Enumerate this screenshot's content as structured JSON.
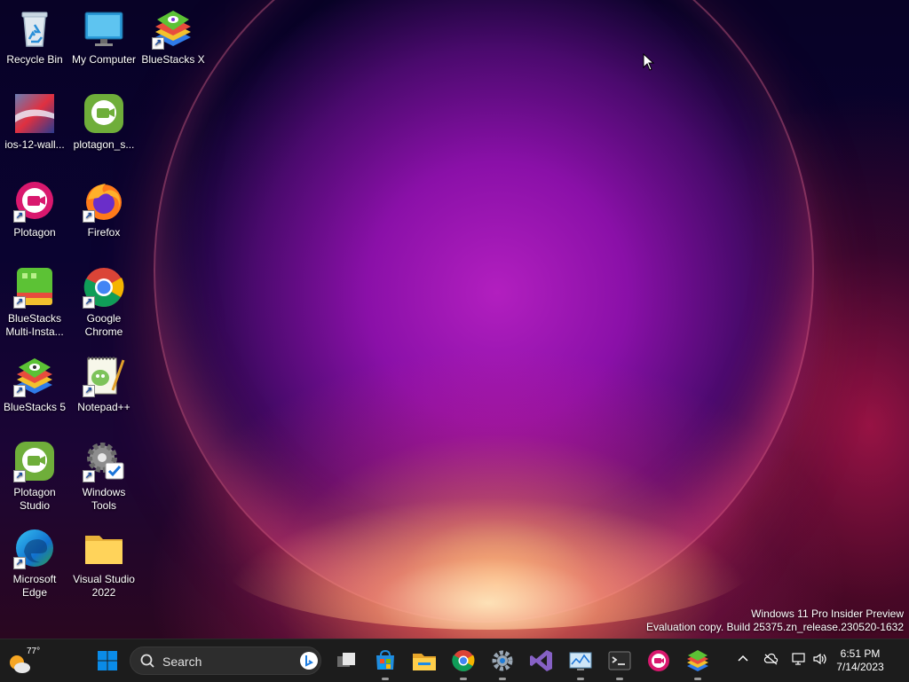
{
  "desktop": {
    "icons": [
      {
        "label": "Recycle Bin",
        "icon": "recycle-bin-icon"
      },
      {
        "label": "My Computer",
        "icon": "monitor-icon"
      },
      {
        "label": "BlueStacks X",
        "icon": "bluestacks-icon"
      },
      {
        "label": "ios-12-wall...",
        "icon": "image-file-icon"
      },
      {
        "label": "plotagon_s...",
        "icon": "plotagon-studio-icon"
      },
      {
        "label": "Plotagon",
        "icon": "plotagon-icon"
      },
      {
        "label": "Firefox",
        "icon": "firefox-icon"
      },
      {
        "label": "BlueStacks Multi-Insta...",
        "icon": "bluestacks-multi-icon"
      },
      {
        "label": "Google Chrome",
        "icon": "chrome-icon"
      },
      {
        "label": "BlueStacks 5",
        "icon": "bluestacks-icon"
      },
      {
        "label": "Notepad++",
        "icon": "notepadpp-icon"
      },
      {
        "label": "Plotagon Studio",
        "icon": "plotagon-studio-icon"
      },
      {
        "label": "Windows Tools",
        "icon": "windows-tools-icon"
      },
      {
        "label": "Microsoft Edge",
        "icon": "edge-icon"
      },
      {
        "label": "Visual Studio 2022",
        "icon": "folder-icon"
      }
    ]
  },
  "watermark": {
    "line1": "Windows 11 Pro Insider Preview",
    "line2": "Evaluation copy. Build 25375.zn_release.230520-1632"
  },
  "taskbar": {
    "weather_temp": "77°",
    "search_label": "Search",
    "time": "6:51 PM",
    "date": "7/14/2023",
    "accent": "#0078d4"
  }
}
